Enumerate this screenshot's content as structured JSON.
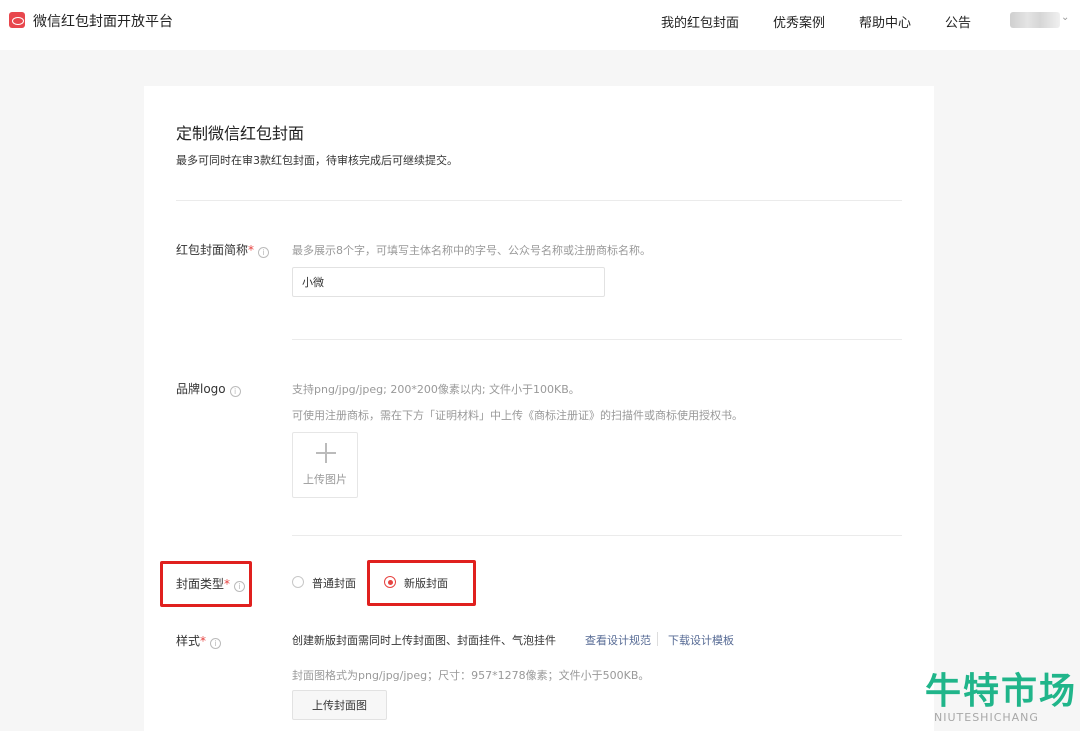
{
  "header": {
    "brand": "微信红包封面开放平台",
    "nav": [
      "我的红包封面",
      "优秀案例",
      "帮助中心",
      "公告"
    ],
    "avatar_chevron": "⌄"
  },
  "page": {
    "title": "定制微信红包封面",
    "subtitle": "最多可同时在审3款红包封面，待审核完成后可继续提交。"
  },
  "form": {
    "required_mark": "*",
    "info_glyph": "i",
    "name": {
      "label": "红包封面简称",
      "hint": "最多展示8个字，可填写主体名称中的字号、公众号名称或注册商标名称。",
      "value": "小微"
    },
    "logo": {
      "label": "品牌logo",
      "hint1": "支持png/jpg/jpeg; 200*200像素以内; 文件小于100KB。",
      "hint2": "可使用注册商标，需在下方「证明材料」中上传《商标注册证》的扫描件或商标使用授权书。",
      "upload_label": "上传图片"
    },
    "cover_type": {
      "label": "封面类型",
      "options": [
        "普通封面",
        "新版封面"
      ],
      "selected": "新版封面"
    },
    "style": {
      "label": "样式",
      "desc": "创建新版封面需同时上传封面图、封面挂件、气泡挂件",
      "link_spec": "查看设计规范",
      "link_template": "下载设计模板",
      "hint": "封面图格式为png/jpg/jpeg；尺寸：957*1278像素；文件小于500KB。",
      "upload_button": "上传封面图"
    }
  },
  "watermark": {
    "cn": "牛特市场",
    "en": "NIUTESHICHANG"
  },
  "colors": {
    "accent_red": "#e64340",
    "highlight_red": "#e0201e",
    "link_blue": "#576b95",
    "watermark_green": "#20b58a"
  }
}
